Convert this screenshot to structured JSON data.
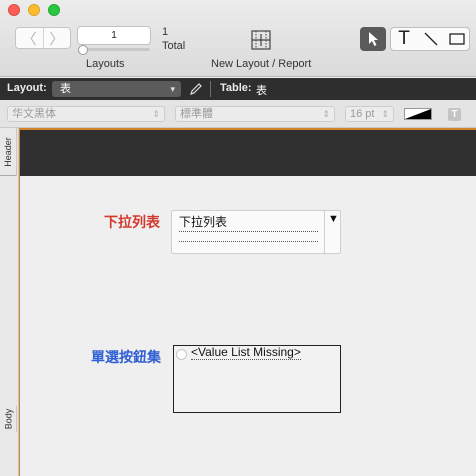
{
  "toolbar": {
    "nav_back": "〈",
    "nav_forward": "〉",
    "record_number": "1",
    "total_count": "1",
    "total_label": "Total",
    "layouts_label": "Layouts",
    "new_layout_label": "New Layout / Report",
    "tools": [
      "pointer-tool",
      "text-tool",
      "line-tool",
      "rectangle-tool"
    ],
    "text_tool_glyph": "T"
  },
  "layoutbar": {
    "layout_label": "Layout:",
    "layout_value": "表",
    "table_label": "Table:",
    "table_value": "表"
  },
  "formatbar": {
    "font_value": "华文黑体",
    "style_value": "標準體",
    "size_value": "16 pt",
    "text_format_glyph": "T"
  },
  "parts": {
    "header_label": "Header",
    "body_label": "Body"
  },
  "fields": {
    "dropdown_label": "下拉列表",
    "dropdown_value": "下拉列表",
    "dropdown_arrow": "▼",
    "radio_label": "單選按鈕集",
    "radio_value": "<Value List Missing>"
  },
  "colors": {
    "dropdown_label": "#d23a2e",
    "radio_label": "#2f5fd4",
    "part_border": "#d2842a",
    "header_part": "#303030"
  }
}
